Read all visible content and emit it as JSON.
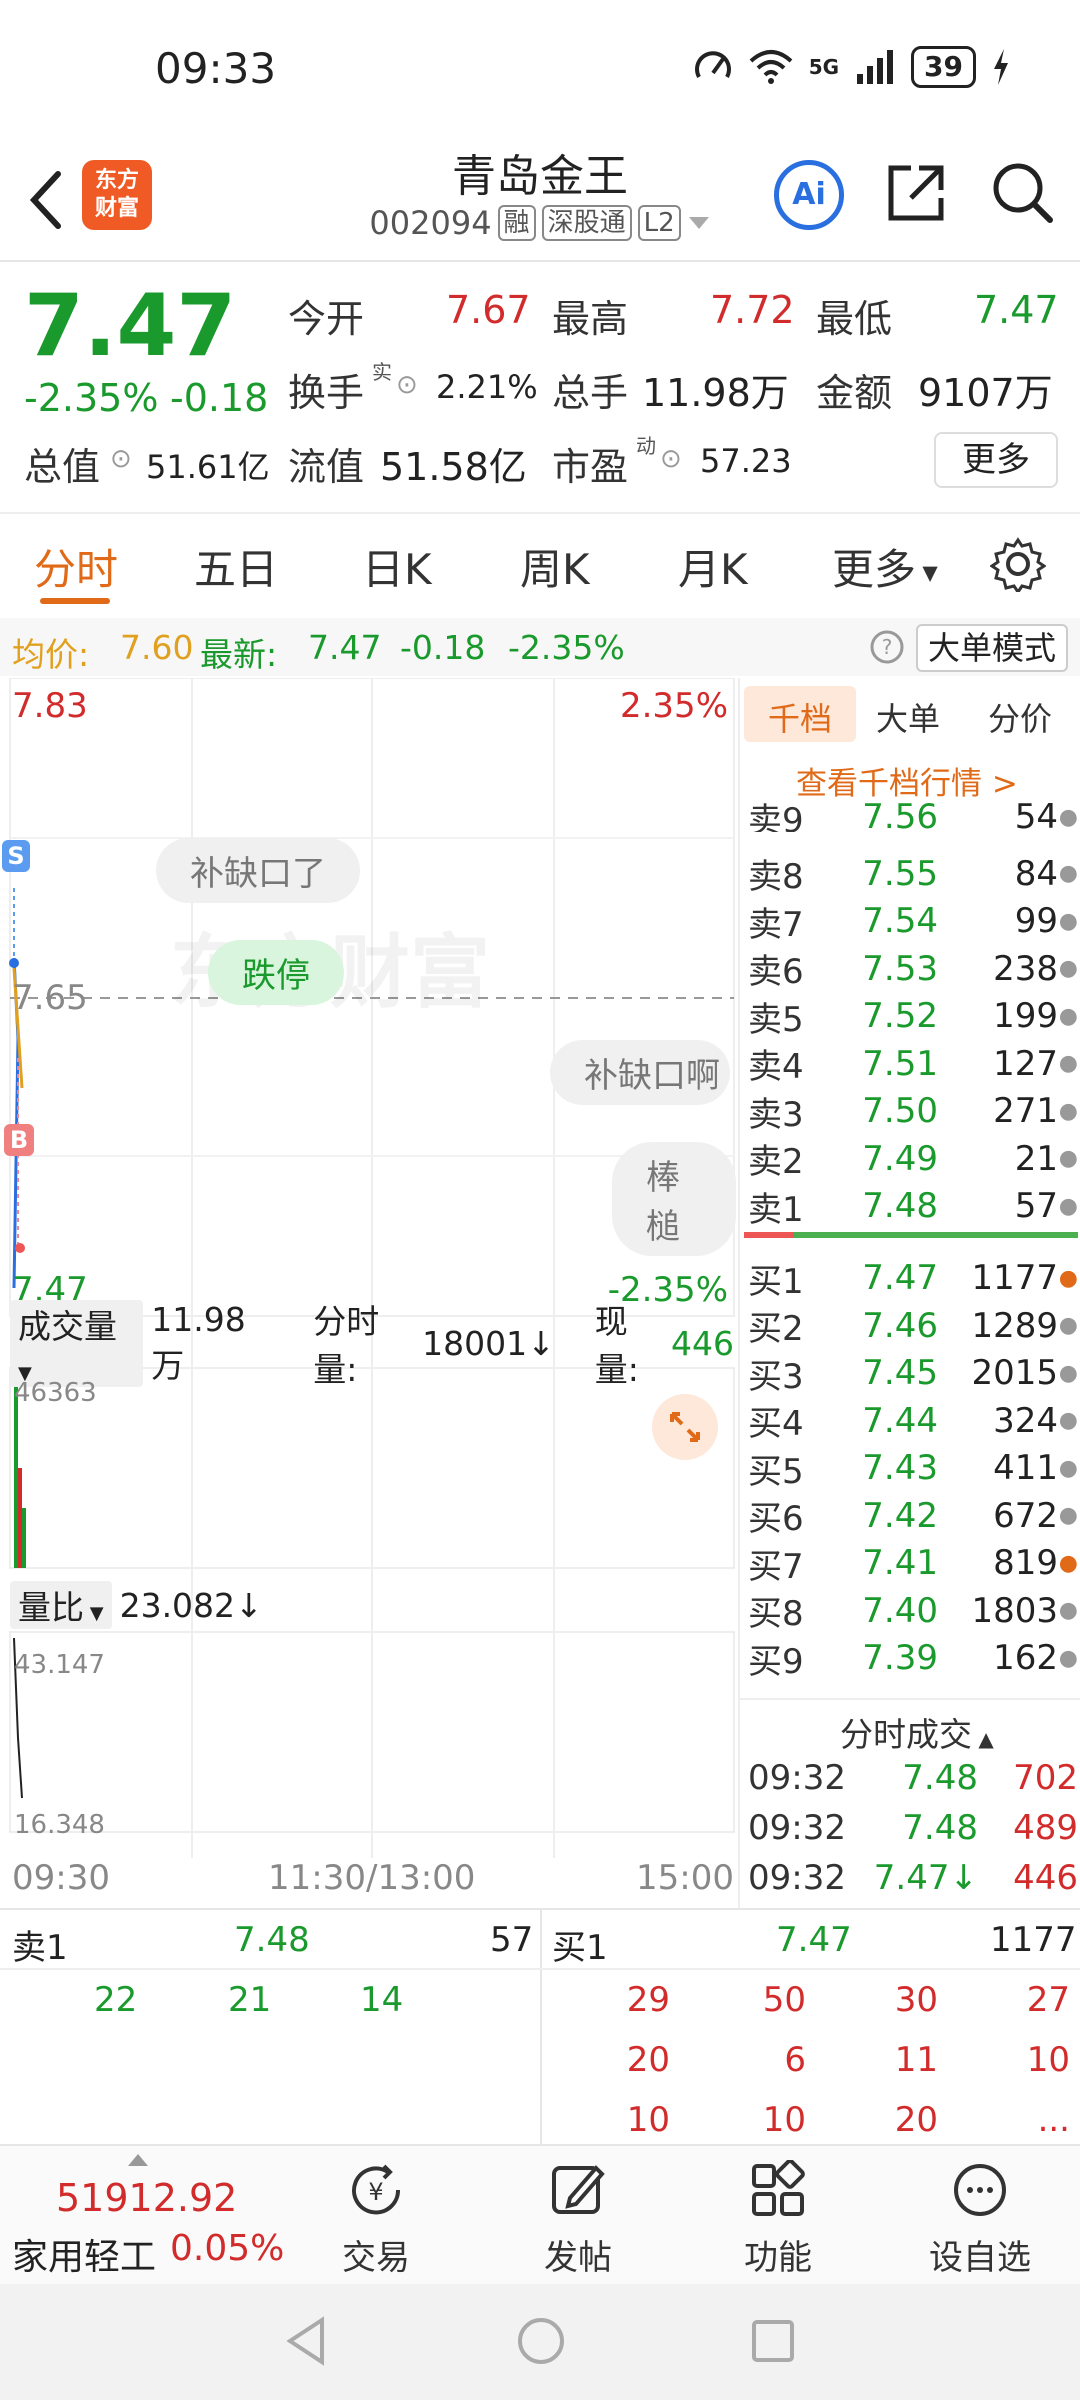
{
  "status": {
    "time": "09:33",
    "network": "5G",
    "battery": "39"
  },
  "header": {
    "logo_line1": "东方",
    "logo_line2": "财富",
    "title": "青岛金王",
    "code": "002094",
    "tags": [
      "融",
      "深股通",
      "L2"
    ],
    "ai_label": "Ai"
  },
  "quote": {
    "last": "7.47",
    "change_pct": "-2.35%",
    "change_amt": "-0.18",
    "open_label": "今开",
    "open": "7.67",
    "high_label": "最高",
    "high": "7.72",
    "low_label": "最低",
    "low": "7.47",
    "turnover_label": "换手",
    "turnover_sup": "实",
    "turnover": "2.21%",
    "volume_label": "总手",
    "volume": "11.98万",
    "amount_label": "金额",
    "amount": "9107万",
    "mktcap_label": "总值",
    "mktcap": "51.61亿",
    "float_label": "流值",
    "float": "51.58亿",
    "pe_label": "市盈",
    "pe_sup": "动",
    "pe": "57.23",
    "more": "更多"
  },
  "tabs": [
    "分时",
    "五日",
    "日K",
    "周K",
    "月K",
    "更多"
  ],
  "avgbar": {
    "avg_label": "均价:",
    "avg": "7.60",
    "latest_label": "最新:",
    "latest": "7.47",
    "latest_chg": "-0.18",
    "latest_pct": "-2.35%",
    "big_order": "大单模式"
  },
  "chart": {
    "top_price": "7.83",
    "top_pct": "2.35%",
    "mid_price": "7.65",
    "bottom_price": "7.47",
    "bottom_pct": "-2.35%",
    "s_marker": "S",
    "b_marker": "B",
    "watermark": "东方财富",
    "bubbles": [
      "补缺口了",
      "跌停",
      "补缺口啊",
      "棒槌"
    ],
    "vol_label": "成交量",
    "vol_total": "11.98万",
    "minute_vol_label": "分时量:",
    "minute_vol": "18001↓",
    "current_vol_label": "现量:",
    "current_vol": "446",
    "vol_max": "46363",
    "ratio_label": "量比",
    "ratio": "23.082↓",
    "ratio_max": "43.147",
    "ratio_min": "16.348",
    "time_start": "09:30",
    "time_mid": "11:30/13:00",
    "time_end": "15:00"
  },
  "book": {
    "tabs": [
      "千档",
      "大单",
      "分价"
    ],
    "link": "查看千档行情 >",
    "asks": [
      {
        "lvl": "卖9",
        "px": "7.56",
        "vol": "54"
      },
      {
        "lvl": "卖8",
        "px": "7.55",
        "vol": "84"
      },
      {
        "lvl": "卖7",
        "px": "7.54",
        "vol": "99"
      },
      {
        "lvl": "卖6",
        "px": "7.53",
        "vol": "238"
      },
      {
        "lvl": "卖5",
        "px": "7.52",
        "vol": "199"
      },
      {
        "lvl": "卖4",
        "px": "7.51",
        "vol": "127"
      },
      {
        "lvl": "卖3",
        "px": "7.50",
        "vol": "271"
      },
      {
        "lvl": "卖2",
        "px": "7.49",
        "vol": "21"
      },
      {
        "lvl": "卖1",
        "px": "7.48",
        "vol": "57"
      }
    ],
    "bids": [
      {
        "lvl": "买1",
        "px": "7.47",
        "vol": "1177"
      },
      {
        "lvl": "买2",
        "px": "7.46",
        "vol": "1289"
      },
      {
        "lvl": "买3",
        "px": "7.45",
        "vol": "2015"
      },
      {
        "lvl": "买4",
        "px": "7.44",
        "vol": "324"
      },
      {
        "lvl": "买5",
        "px": "7.43",
        "vol": "411"
      },
      {
        "lvl": "买6",
        "px": "7.42",
        "vol": "672"
      },
      {
        "lvl": "买7",
        "px": "7.41",
        "vol": "819"
      },
      {
        "lvl": "买8",
        "px": "7.40",
        "vol": "1803"
      },
      {
        "lvl": "买9",
        "px": "7.39",
        "vol": "162"
      }
    ],
    "ticks_title": "分时成交",
    "ticks": [
      {
        "t": "09:32",
        "p": "7.48",
        "v": "702"
      },
      {
        "t": "09:32",
        "p": "7.48",
        "v": "489"
      },
      {
        "t": "09:32",
        "p": "7.47↓",
        "v": "446"
      }
    ]
  },
  "queue": {
    "sell_label": "卖1",
    "sell_px": "7.48",
    "sell_vol": "57",
    "sell_orders": [
      "22",
      "21",
      "14"
    ],
    "buy_label": "买1",
    "buy_px": "7.47",
    "buy_vol": "1177",
    "buy_orders": [
      "29",
      "50",
      "30",
      "27",
      "20",
      "6",
      "11",
      "10",
      "10",
      "10",
      "20",
      "..."
    ]
  },
  "toolbar": {
    "index_value": "51912.92",
    "index_name": "家用轻工",
    "index_pct": "0.05%",
    "items": [
      "交易",
      "发帖",
      "功能",
      "设自选"
    ]
  }
}
